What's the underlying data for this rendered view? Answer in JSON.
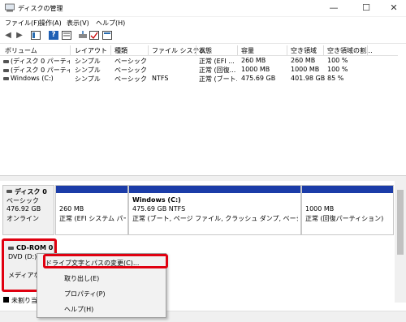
{
  "window": {
    "title": "ディスクの管理",
    "minimize": "—",
    "maximize": "☐",
    "close": "✕"
  },
  "menu": [
    "ファイル(F)",
    "操作(A)",
    "表示(V)",
    "ヘルプ(H)"
  ],
  "toolbar": {
    "back": "◀",
    "forward": "▶",
    "help": "?"
  },
  "columns": [
    "ボリューム",
    "レイアウト",
    "種類",
    "ファイル システム",
    "状態",
    "容量",
    "空き領域",
    "空き領域の割..."
  ],
  "volumes": [
    [
      "(ディスク 0 パーティショ...",
      "シンプル",
      "ベーシック",
      "",
      "正常 (EFI ...",
      "260 MB",
      "260 MB",
      "100 %"
    ],
    [
      "(ディスク 0 パーティショ...",
      "シンプル",
      "ベーシック",
      "",
      "正常 (回復...",
      "1000 MB",
      "1000 MB",
      "100 %"
    ],
    [
      "Windows (C:)",
      "シンプル",
      "ベーシック",
      "NTFS",
      "正常 (ブート...",
      "475.69 GB",
      "401.98 GB",
      "85 %"
    ]
  ],
  "disk0": {
    "name": "ディスク 0",
    "type": "ベーシック",
    "size": "476.92 GB",
    "status": "オンライン",
    "partitions": [
      {
        "title": "",
        "size": "260 MB",
        "status": "正常 (EFI システム パーティ"
      },
      {
        "title": "Windows  (C:)",
        "size": "475.69 GB NTFS",
        "status": "正常 (ブート, ページ ファイル, クラッシュ ダンプ, ベーシック データ パーティ"
      },
      {
        "title": "",
        "size": "1000 MB",
        "status": "正常 (回復パーティション)"
      }
    ]
  },
  "cdrom": {
    "name": "CD-ROM 0",
    "drive": "DVD (D:)",
    "media": "メディアなし"
  },
  "context_menu": [
    "ドライブ文字とパスの変更(C)...",
    "取り出し(E)",
    "プロパティ(P)",
    "ヘルプ(H)"
  ],
  "legend": {
    "unallocated": "未割り当て"
  },
  "colors": {
    "partition_bar": "#1b3ca8",
    "highlight_border": "#e00010"
  }
}
